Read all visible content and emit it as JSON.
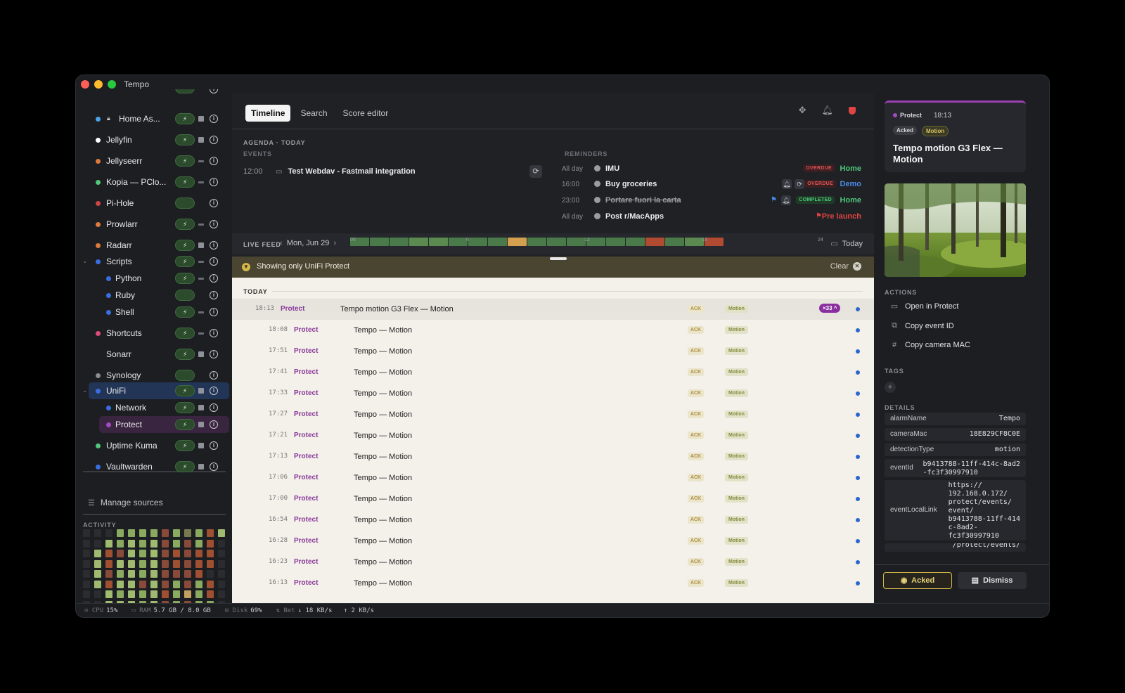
{
  "app_title": "Tempo",
  "sidebar": {
    "items": [
      {
        "label": "Home As...",
        "color": "#4aa3e8",
        "locked": true,
        "toggle": "on",
        "sq": "square"
      },
      {
        "label": "Jellyfin",
        "color": "#ffffff",
        "toggle": "on",
        "sq": "square"
      },
      {
        "label": "Jellyseerr",
        "color": "#e07a3a",
        "toggle": "on",
        "sq": "dash"
      },
      {
        "label": "Kopia — PClo...",
        "color": "#4fc87a",
        "toggle": "on",
        "sq": "dash"
      },
      {
        "label": "Pi-Hole",
        "color": "#d04444",
        "toggle": "off",
        "sq": "none"
      },
      {
        "label": "Prowlarr",
        "color": "#e07a3a",
        "toggle": "on",
        "sq": "dash"
      },
      {
        "label": "Radarr",
        "color": "#e07a3a",
        "toggle": "on",
        "sq": "square"
      },
      {
        "label": "Scripts",
        "color": "#3a6ee0",
        "toggle": "on",
        "sq": "dash",
        "expanded": true
      },
      {
        "label": "Python",
        "color": "#3a6ee0",
        "toggle": "on",
        "sq": "dash",
        "child": true
      },
      {
        "label": "Ruby",
        "color": "#3a6ee0",
        "toggle": "off",
        "sq": "none",
        "child": true
      },
      {
        "label": "Shell",
        "color": "#3a6ee0",
        "toggle": "on",
        "sq": "dash",
        "child": true
      },
      {
        "label": "Shortcuts",
        "color": "#e04a7a",
        "toggle": "on",
        "sq": "dash"
      },
      {
        "label": "Sonarr",
        "color": "",
        "toggle": "on",
        "sq": "square"
      },
      {
        "label": "Synology",
        "color": "#8a8d94",
        "toggle": "off",
        "sq": "none"
      },
      {
        "label": "UniFi",
        "color": "#3a6ee0",
        "toggle": "on",
        "sq": "square",
        "expanded": true,
        "selected": "unifi"
      },
      {
        "label": "Network",
        "color": "#3a6ee0",
        "toggle": "on",
        "sq": "square",
        "child": true
      },
      {
        "label": "Protect",
        "color": "#a44ac0",
        "toggle": "on",
        "sq": "square",
        "child": true,
        "selected": "protect"
      },
      {
        "label": "Uptime Kuma",
        "color": "#4fc87a",
        "toggle": "on",
        "sq": "square"
      },
      {
        "label": "Vaultwarden",
        "color": "#3a6ee0",
        "toggle": "on",
        "sq": "square"
      }
    ],
    "manage_label": "Manage sources",
    "activity_label": "ACTIVITY"
  },
  "tabs": [
    "Timeline",
    "Search",
    "Score editor"
  ],
  "agenda": {
    "title": "AGENDA · TODAY",
    "events_label": "EVENTS",
    "reminders_label": "REMINDERS",
    "events": [
      {
        "time": "12:00",
        "title": "Test Webdav - Fastmail integration"
      }
    ],
    "reminders": [
      {
        "time": "All day",
        "title": "IMU",
        "badge": "OVERDUE",
        "list": "Home",
        "list_color": "#4fc87a"
      },
      {
        "time": "16:00",
        "title": "Buy groceries",
        "badge": "OVERDUE",
        "list": "Demo",
        "list_color": "#4a8ae8"
      },
      {
        "time": "23:00",
        "title": "Portare fuori la carta",
        "badge": "COMPLETED",
        "list": "Home",
        "list_color": "#4fc87a"
      },
      {
        "time": "All day",
        "title": "Post r/MacApps",
        "badge": "",
        "list": "Pre launch",
        "list_color": "#e04444"
      }
    ]
  },
  "live_feed": {
    "label": "LIVE FEED",
    "date": "Mon, Jun 29",
    "hour_labels": [
      "00",
      "6",
      "12",
      "18",
      "24"
    ],
    "segments": [
      "#4a7a4a",
      "#4a7a4a",
      "#4a7a4a",
      "#5a8a50",
      "#5a8a50",
      "#4a7a4a",
      "#4a7a4a",
      "#4a7a4a",
      "#d4a050",
      "#4a7a4a",
      "#4a7a4a",
      "#4a7a4a",
      "#4a7a4a",
      "#4a7a4a",
      "#4a7a4a",
      "#b04a30",
      "#4a7a4a",
      "#5a8a50",
      "#b04a30"
    ],
    "today_label": "Today"
  },
  "filter": {
    "text": "Showing only UniFi Protect",
    "clear_label": "Clear"
  },
  "feed": {
    "section_label": "TODAY",
    "rows": [
      {
        "time": "18:13",
        "source": "Protect",
        "title": "Tempo motion G3 Flex — Motion",
        "ack": "ACK",
        "tag": "Motion",
        "count": "×33 ^",
        "first": true
      },
      {
        "time": "18:08",
        "source": "Protect",
        "title": "Tempo — Motion",
        "ack": "ACK",
        "tag": "Motion"
      },
      {
        "time": "17:51",
        "source": "Protect",
        "title": "Tempo — Motion",
        "ack": "ACK",
        "tag": "Motion"
      },
      {
        "time": "17:41",
        "source": "Protect",
        "title": "Tempo — Motion",
        "ack": "ACK",
        "tag": "Motion"
      },
      {
        "time": "17:33",
        "source": "Protect",
        "title": "Tempo — Motion",
        "ack": "ACK",
        "tag": "Motion"
      },
      {
        "time": "17:27",
        "source": "Protect",
        "title": "Tempo — Motion",
        "ack": "ACK",
        "tag": "Motion"
      },
      {
        "time": "17:21",
        "source": "Protect",
        "title": "Tempo — Motion",
        "ack": "ACK",
        "tag": "Motion"
      },
      {
        "time": "17:13",
        "source": "Protect",
        "title": "Tempo — Motion",
        "ack": "ACK",
        "tag": "Motion"
      },
      {
        "time": "17:06",
        "source": "Protect",
        "title": "Tempo — Motion",
        "ack": "ACK",
        "tag": "Motion"
      },
      {
        "time": "17:00",
        "source": "Protect",
        "title": "Tempo — Motion",
        "ack": "ACK",
        "tag": "Motion"
      },
      {
        "time": "16:54",
        "source": "Protect",
        "title": "Tempo — Motion",
        "ack": "ACK",
        "tag": "Motion"
      },
      {
        "time": "16:28",
        "source": "Protect",
        "title": "Tempo — Motion",
        "ack": "ACK",
        "tag": "Motion"
      },
      {
        "time": "16:23",
        "source": "Protect",
        "title": "Tempo — Motion",
        "ack": "ACK",
        "tag": "Motion"
      },
      {
        "time": "16:13",
        "source": "Protect",
        "title": "Tempo — Motion",
        "ack": "ACK",
        "tag": "Motion"
      }
    ]
  },
  "detail": {
    "source": "Protect",
    "time": "18:13",
    "chips": [
      "Acked",
      "Motion"
    ],
    "title": "Tempo motion G3 Flex — Motion",
    "actions_label": "ACTIONS",
    "actions": [
      "Open in Protect",
      "Copy event ID",
      "Copy camera MAC"
    ],
    "tags_label": "TAGS",
    "details_label": "DETAILS",
    "details": [
      {
        "key": "alarmName",
        "value": "Tempo"
      },
      {
        "key": "cameraMac",
        "value": "18E829CF8C0E"
      },
      {
        "key": "detectionType",
        "value": "motion"
      },
      {
        "key": "eventId",
        "value": "b9413788-11ff-414c-8ad2\n-fc3f30997910"
      },
      {
        "key": "eventLocalLink",
        "value": "https://\n192.168.0.172/\nprotect/events/\nevent/\nb9413788-11ff-414\nc-8ad2-\nfc3f30997910"
      },
      {
        "key": "",
        "value": "/protect/events/"
      }
    ],
    "ack_button": "Acked",
    "dismiss_button": "Dismiss"
  },
  "status": {
    "cpu_label": "CPU",
    "cpu": "15%",
    "ram_label": "RAM",
    "ram": "5.7 GB / 8.0 GB",
    "disk_label": "Disk",
    "disk": "69%",
    "net_label": "Net",
    "down": "↓ 18 KB/s",
    "up": "↑ 2 KB/s"
  }
}
